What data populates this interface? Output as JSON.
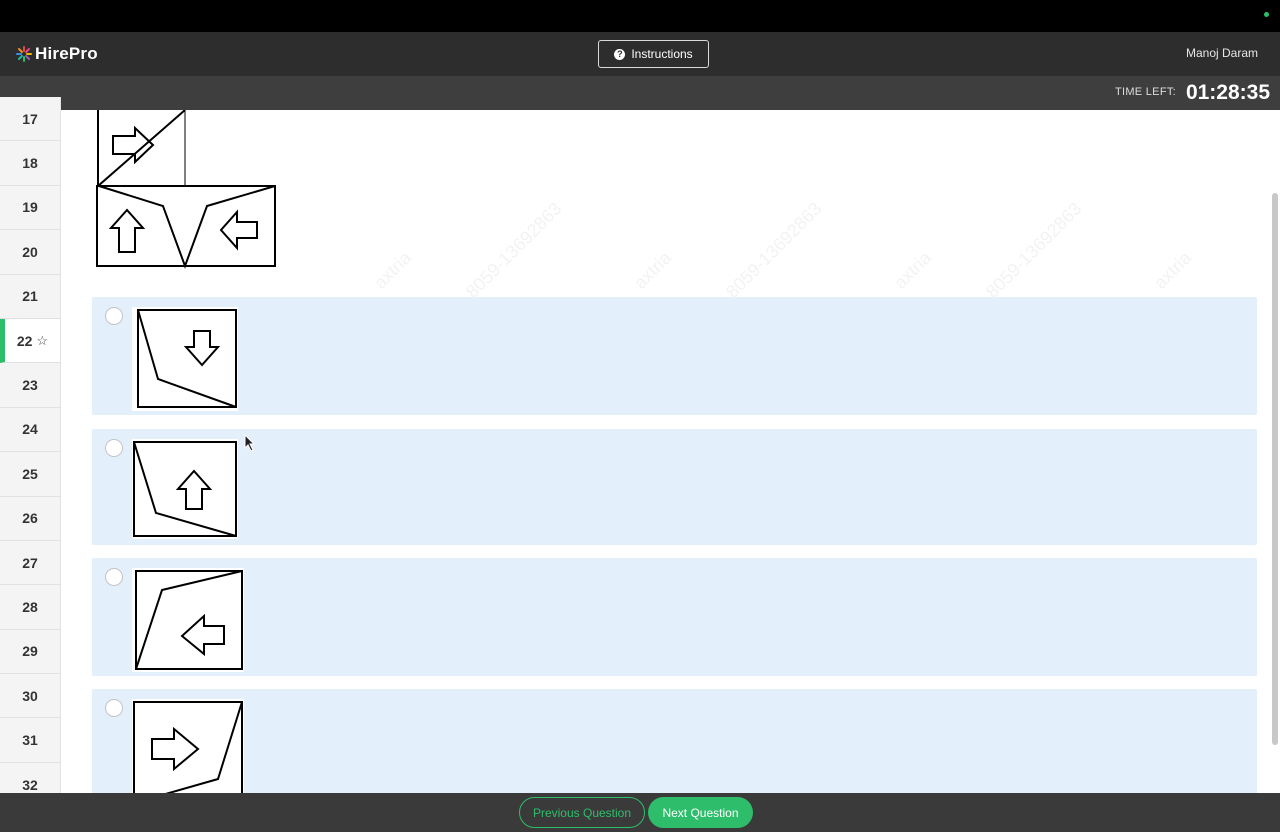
{
  "app": {
    "logo_text": "HirePro"
  },
  "header": {
    "instructions_label": "Instructions",
    "user_name": "Manoj Daram"
  },
  "timer": {
    "label": "TIME LEFT:",
    "value": "01:28:35"
  },
  "sidebar": {
    "current_question": "22",
    "items": [
      {
        "label": "17"
      },
      {
        "label": "18"
      },
      {
        "label": "19"
      },
      {
        "label": "20"
      },
      {
        "label": "21"
      },
      {
        "label": "22"
      },
      {
        "label": "23"
      },
      {
        "label": "24"
      },
      {
        "label": "25"
      },
      {
        "label": "26"
      },
      {
        "label": "27"
      },
      {
        "label": "28"
      },
      {
        "label": "29"
      },
      {
        "label": "30"
      },
      {
        "label": "31"
      },
      {
        "label": "32"
      }
    ]
  },
  "watermark": {
    "lines": [
      "axtria",
      "8059-13692863"
    ]
  },
  "options": [
    {
      "selected": false,
      "figure": "arrow-down"
    },
    {
      "selected": false,
      "figure": "arrow-up"
    },
    {
      "selected": false,
      "figure": "arrow-left"
    },
    {
      "selected": false,
      "figure": "arrow-right"
    }
  ],
  "footer": {
    "prev_label": "Previous Question",
    "next_label": "Next Question"
  },
  "colors": {
    "accent": "#2ebd6b",
    "header": "#2d2d2d",
    "option_bg": "#e4effc"
  }
}
